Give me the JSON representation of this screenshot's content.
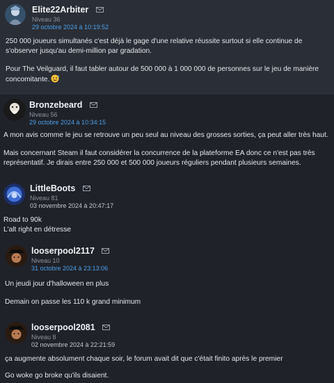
{
  "posts": [
    {
      "username": "Elite22Arbiter",
      "level": "Niveau 36",
      "date": "29 octobre 2024 à 10:19:52",
      "paragraphs": [
        "250 000 joueurs simultanés c'est déjà le gage d'une relative réussite surtout si elle continue de s'observer jusqu'au demi-million par gradation.",
        "Pour The Veilguard, il faut tabler autour de 500 000 à 1 000 000 de personnes sur le jeu de manière concomitante."
      ]
    },
    {
      "username": "Bronzebeard",
      "level": "Niveau 56",
      "date": "29 octobre 2024 à 10:34:15",
      "paragraphs": [
        "A mon avis comme le jeu se retrouve un peu seul au niveau des grosses sorties, ça peut aller très haut.",
        "Mais concernant Steam il faut considérer la concurrence de la plateforme EA donc ce n'est pas très représentatif. Je dirais entre 250 000 et 500 000 joueurs réguliers pendant plusieurs semaines."
      ]
    },
    {
      "username": "LittleBoots",
      "level": "Niveau 81",
      "date": "03 novembre 2024 à 20:47:17",
      "paragraphs": [
        "Road to 90k",
        "L'alt right en détresse"
      ]
    },
    {
      "username": "looserpool2117",
      "level": "Niveau 10",
      "date": "31 octobre 2024 à 23:13:06",
      "paragraphs": [
        "Un jeudi jour d'halloween en plus",
        "Demain on passe les 110 k grand minimum"
      ]
    },
    {
      "username": "looserpool2081",
      "level": "Niveau 8",
      "date": "02 novembre 2024 à 22:21:59",
      "paragraphs": [
        "ça augmente absolument chaque soir, le forum avait dit que c'était finito après le premier",
        "Go woke go broke qu'ils disaient."
      ]
    }
  ],
  "icons": {
    "mail": "envelope-icon",
    "emoji": "sweat-smile-emoji-icon"
  },
  "colors": {
    "date_link": "#4d9fe8",
    "post_bg_alt": "#2a2e36",
    "post_bg_dark": "#1f2229"
  }
}
